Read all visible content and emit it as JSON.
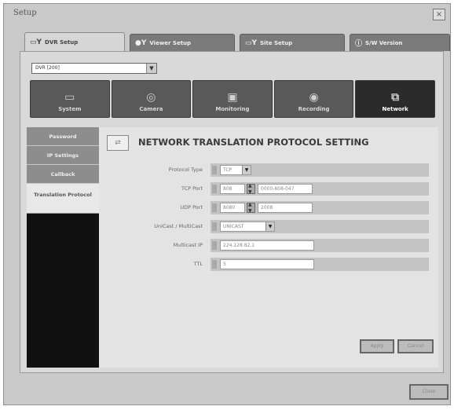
{
  "window": {
    "title": "Setup",
    "close_glyph": "×"
  },
  "tabs": [
    {
      "label": "DVR Setup",
      "icon": "wrench-icon",
      "glyph": "▭Y",
      "active": true
    },
    {
      "label": "Viewer Setup",
      "icon": "wrench-icon",
      "glyph": "●Y",
      "active": false
    },
    {
      "label": "Site Setup",
      "icon": "wrench-icon",
      "glyph": "▭Y",
      "active": false
    },
    {
      "label": "S/W Version",
      "icon": "info-icon",
      "glyph": "ⓘ",
      "active": false
    }
  ],
  "site_select": {
    "value": "DVR [200]",
    "arrow": "▼"
  },
  "categories": [
    {
      "label": "System",
      "icon": "monitor-icon",
      "glyph": "▭",
      "active": false
    },
    {
      "label": "Camera",
      "icon": "camera-icon",
      "glyph": "◎",
      "active": false
    },
    {
      "label": "Monitoring",
      "icon": "screen-icon",
      "glyph": "▣",
      "active": false
    },
    {
      "label": "Recording",
      "icon": "record-icon",
      "glyph": "◉",
      "active": false
    },
    {
      "label": "Network",
      "icon": "network-icon",
      "glyph": "⧉",
      "active": true
    }
  ],
  "side_menu": [
    {
      "label": "Password",
      "active": false
    },
    {
      "label": "IP Settings",
      "active": false
    },
    {
      "label": "Callback",
      "active": false
    },
    {
      "label": "Translation Protocol",
      "active": true
    }
  ],
  "content": {
    "heading": "NETWORK TRANSLATION PROTOCOL SETTING",
    "heading_icon": "network-protocol-icon",
    "fields": {
      "protocol_type": {
        "label": "Protocol Type",
        "value": "TCP"
      },
      "tcp_port": {
        "label": "TCP Port",
        "value": "808",
        "range": "0000-808-047"
      },
      "udp_port": {
        "label": "UDP Port",
        "value": "8080",
        "range": "2008"
      },
      "unicast_multicast": {
        "label": "UniCast / MultiCast",
        "value": "UNICAST"
      },
      "multicast_ip": {
        "label": "Multicast IP",
        "value": "224.128.82.1"
      },
      "ttl": {
        "label": "TTL",
        "value": "5"
      }
    },
    "buttons": {
      "apply": "Apply",
      "cancel": "Cancel"
    }
  },
  "footer": {
    "close_label": "Close"
  },
  "colors": {
    "active_category": "#2b2b2b",
    "inactive_category": "#595959",
    "sidenav_bg": "#111111"
  }
}
